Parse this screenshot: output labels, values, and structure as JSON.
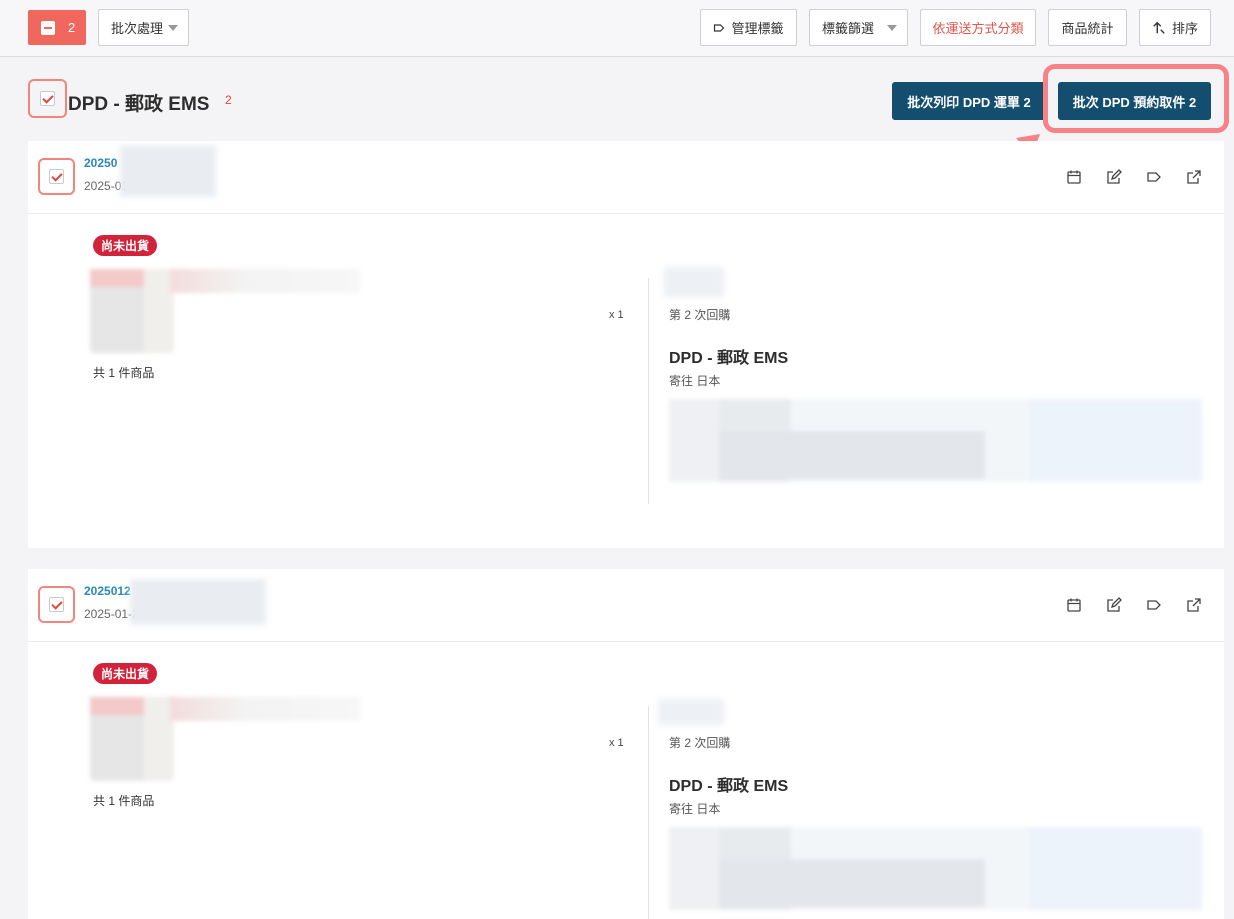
{
  "toolbar": {
    "selected_count": "2",
    "batch_process": "批次處理",
    "manage_tags": "管理標籤",
    "tag_filter": "標籤篩選",
    "classify_by_shipping": "依運送方式分類",
    "product_stats": "商品統計",
    "sort": "排序"
  },
  "group": {
    "title": "DPD - 郵政 EMS",
    "count": "2",
    "print_button": "批次列印 DPD 運單 2",
    "pickup_button": "批次 DPD 預約取件 2"
  },
  "orders": [
    {
      "id": "20250",
      "date": "2025-01-24",
      "status": "尚未出貨",
      "qty": "x 1",
      "total": "共 1 件商品",
      "repeat": "第 2 次回購",
      "ship_method": "DPD - 郵政 EMS",
      "ship_to": "寄往 日本"
    },
    {
      "id": "2025012",
      "date": "2025-01-24",
      "status": "尚未出貨",
      "qty": "x 1",
      "total": "共 1 件商品",
      "repeat": "第 2 次回購",
      "ship_method": "DPD - 郵政 EMS",
      "ship_to": "寄往 日本"
    }
  ],
  "colors": {
    "accent": "#f0685d",
    "primary_dark": "#134e6f",
    "status_red": "#d1233a",
    "link_blue": "#2a88b8",
    "highlight": "#f58388"
  }
}
